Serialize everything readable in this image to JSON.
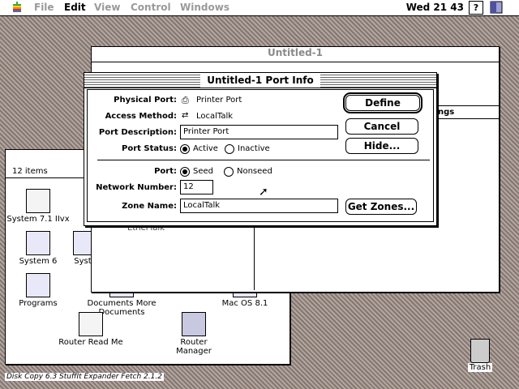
{
  "menubar": {
    "items": [
      "File",
      "Edit",
      "View",
      "Control",
      "Windows"
    ],
    "active_index": 1,
    "clock": "Wed 21 43",
    "help": "?"
  },
  "finder_window": {
    "items_count": "12 items",
    "icons": [
      {
        "label": "System 7.1 IIvx",
        "kind": "doc"
      },
      {
        "label": "System 6",
        "kind": "folder"
      },
      {
        "label": "Syste",
        "kind": "folder"
      },
      {
        "label": "Programs",
        "kind": "folder"
      },
      {
        "label": "Documents More Documents",
        "kind": "folder"
      },
      {
        "label": "Mac OS 8.1",
        "kind": "folder"
      },
      {
        "label": "Router Read Me",
        "kind": "doc"
      },
      {
        "label": "Router Manager",
        "kind": "app"
      }
    ]
  },
  "untitled_window": {
    "title": "Untitled-1",
    "col_header": "ngs",
    "row_label": "EtherTalk"
  },
  "dialog": {
    "title": "Untitled-1 Port Info",
    "physical_port_label": "Physical Port:",
    "physical_port_value": "Printer Port",
    "access_method_label": "Access Method:",
    "access_method_value": "LocalTalk",
    "port_description_label": "Port Description:",
    "port_description_value": "Printer Port",
    "port_status_label": "Port Status:",
    "status_active": "Active",
    "status_inactive": "Inactive",
    "port_label": "Port:",
    "port_seed": "Seed",
    "port_nonseed": "Nonseed",
    "network_number_label": "Network Number:",
    "network_number_value": "12",
    "zone_name_label": "Zone Name:",
    "zone_name_value": "LocalTalk",
    "define_button": "Define",
    "cancel_button": "Cancel",
    "hide_button": "Hide...",
    "get_zones_button": "Get Zones..."
  },
  "desktop": {
    "trash_label": "Trash",
    "bottom_strip": "Disk Copy 6.3 StuffIt Expander Fetch 2.1.2"
  }
}
